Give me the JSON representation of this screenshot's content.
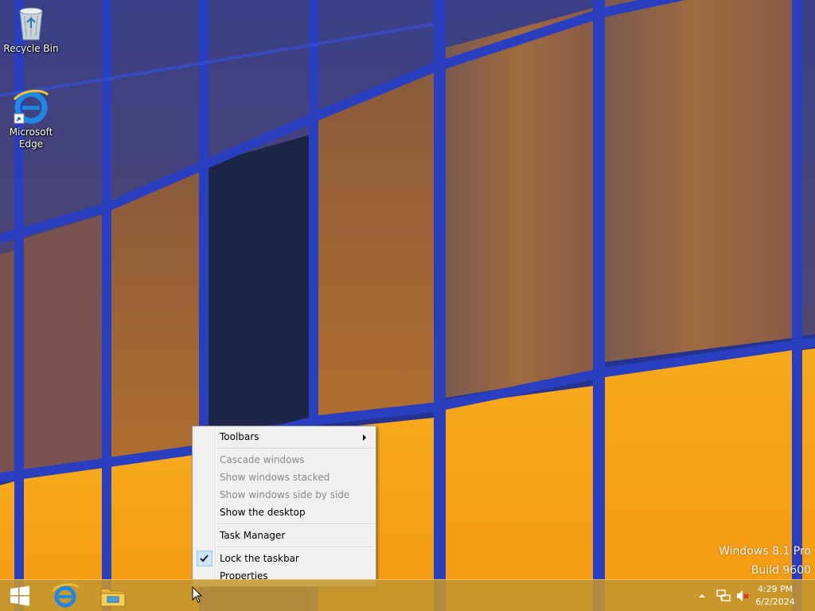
{
  "desktop": {
    "icons": [
      {
        "label": "Recycle Bin",
        "icon": "recycle-bin-icon"
      },
      {
        "label": "Microsoft\nEdge",
        "icon": "edge-icon"
      }
    ],
    "watermark": {
      "line1": "Windows 8.1 Pro",
      "line2": "Build 9600"
    }
  },
  "context_menu": {
    "items": [
      {
        "label": "Toolbars",
        "enabled": true,
        "submenu": true
      },
      {
        "label": "Cascade windows",
        "enabled": false
      },
      {
        "label": "Show windows stacked",
        "enabled": false
      },
      {
        "label": "Show windows side by side",
        "enabled": false
      },
      {
        "label": "Show the desktop",
        "enabled": true
      },
      {
        "label": "Task Manager",
        "enabled": true
      },
      {
        "label": "Lock the taskbar",
        "enabled": true,
        "checked": true
      },
      {
        "label": "Properties",
        "enabled": true
      }
    ]
  },
  "taskbar": {
    "pinned": [
      {
        "icon": "windows-logo-icon",
        "label": "Start"
      },
      {
        "icon": "internet-explorer-icon"
      },
      {
        "icon": "file-explorer-icon"
      }
    ],
    "tray": {
      "icons": [
        "show-hidden-icons-icon",
        "network-icon",
        "volume-muted-icon"
      ],
      "time": "4:29 PM",
      "date": "6/2/2024"
    }
  },
  "colors": {
    "wallpaper_frame": "#2339b8",
    "wallpaper_glass_dark": "#4a3a5a",
    "wallpaper_glass_lit": "#f6a21a",
    "taskbar": "#c49630",
    "menu_bg": "#f0f0f0",
    "menu_disabled_text": "#8a8a8a"
  }
}
